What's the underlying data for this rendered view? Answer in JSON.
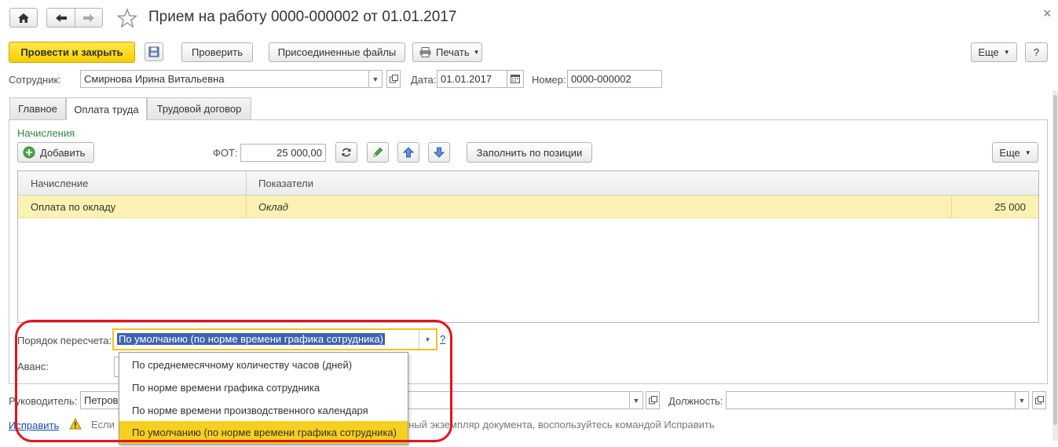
{
  "window": {
    "title": "Прием на работу 0000-000002 от 01.01.2017",
    "close_glyph": "×"
  },
  "toolbar": {
    "post_close_label": "Провести и закрыть",
    "check_label": "Проверить",
    "attached_files_label": "Присоединенные файлы",
    "print_label": "Печать",
    "more_label": "Еще",
    "help_label": "?"
  },
  "header": {
    "employee_label": "Сотрудник:",
    "employee_value": "Смирнова Ирина Витальевна",
    "date_label": "Дата:",
    "date_value": "01.01.2017",
    "number_label": "Номер:",
    "number_value": "0000-000002"
  },
  "tabs": [
    {
      "label": "Главное"
    },
    {
      "label": "Оплата труда"
    },
    {
      "label": "Трудовой договор"
    }
  ],
  "accruals": {
    "section_title": "Начисления",
    "add_label": "Добавить",
    "fot_label": "ФОТ:",
    "fot_value": "25 000,00",
    "fill_label": "Заполнить по позиции",
    "more_label": "Еще",
    "columns": [
      "Начисление",
      "Показатели"
    ],
    "rows": [
      {
        "accrual": "Оплата по окладу",
        "indicator": "Оклад",
        "value": "25 000"
      }
    ]
  },
  "recalc": {
    "label": "Порядок пересчета:",
    "value": "По умолчанию (по норме времени графика сотрудника)",
    "help": "?",
    "options": [
      "По среднемесячному количеству часов (дней)",
      "По норме времени графика сотрудника",
      "По норме времени производственного календаря",
      "По умолчанию (по норме времени графика сотрудника)"
    ],
    "selected_index": 3
  },
  "advance": {
    "label": "Аванс:"
  },
  "footer": {
    "manager_label": "Руководитель:",
    "manager_value": "Петров",
    "position_label": "Должность:",
    "position_value": "",
    "fix_link": "Исправить",
    "info_start": "Если",
    "info_end": "ный экземпляр документа, воспользуйтесь командой Исправить"
  },
  "colors": {
    "accent_yellow": "#f7cf1f",
    "row_highlight": "#fbf1b3",
    "section_green": "#2d8c3c",
    "highlight_red": "#e3141e",
    "link_blue": "#1a4fb0"
  }
}
